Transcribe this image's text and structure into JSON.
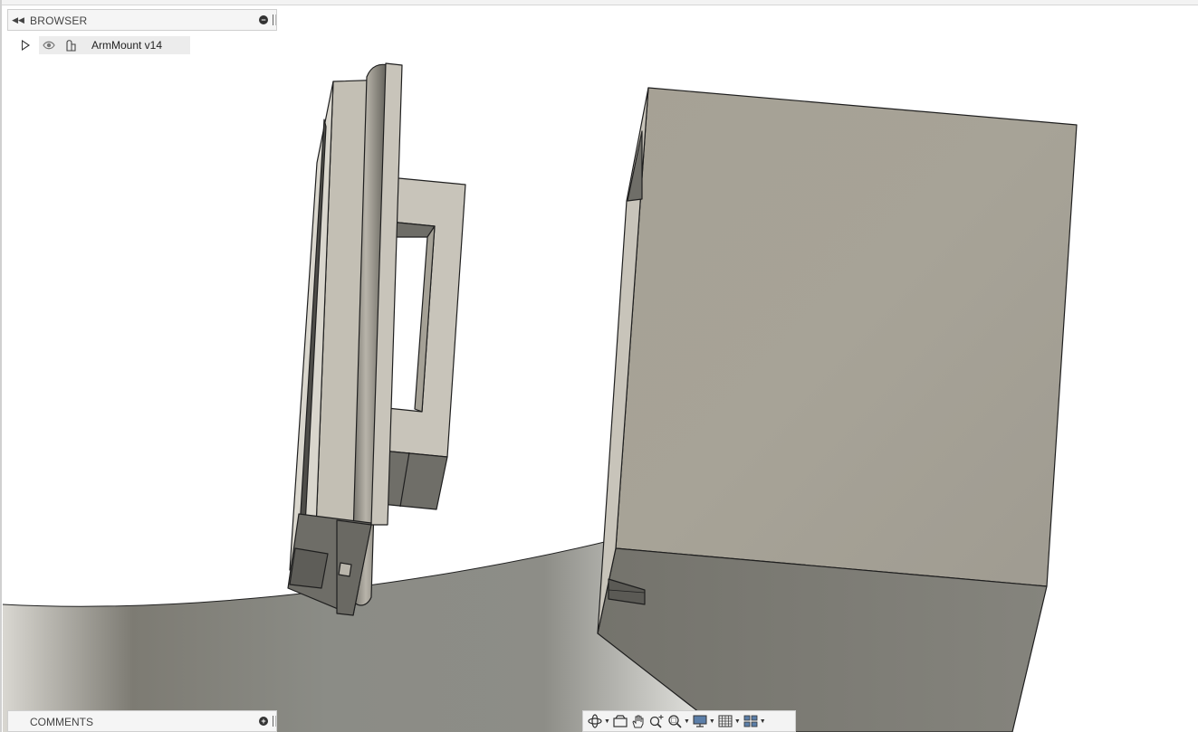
{
  "browser": {
    "title": "BROWSER",
    "collapse_icon": "double-chevron-left-icon",
    "close_icon": "minus-circle-icon",
    "items": [
      {
        "label": "ArmMount v14",
        "expand_icon": "triangle-right-icon",
        "visibility_icon": "eye-icon",
        "type_icon": "component-icon"
      }
    ]
  },
  "comments": {
    "title": "COMMENTS",
    "add_icon": "plus-circle-icon"
  },
  "nav_toolbar": {
    "tools": [
      {
        "name": "orbit",
        "icon": "orbit-icon",
        "has_dropdown": true
      },
      {
        "name": "look-at",
        "icon": "look-at-icon",
        "has_dropdown": false
      },
      {
        "name": "pan",
        "icon": "hand-icon",
        "has_dropdown": false
      },
      {
        "name": "zoom",
        "icon": "zoom-icon",
        "has_dropdown": false
      },
      {
        "name": "fit",
        "icon": "zoom-window-icon",
        "has_dropdown": true
      },
      {
        "name": "display-settings",
        "icon": "monitor-icon",
        "has_dropdown": true
      },
      {
        "name": "grid-and-snaps",
        "icon": "grid-icon",
        "has_dropdown": true
      },
      {
        "name": "viewports",
        "icon": "viewports-icon",
        "has_dropdown": true
      }
    ]
  },
  "colors": {
    "model_face_light": "#a9a49a",
    "model_face_mid": "#c9c5bb",
    "model_face_dark": "#7b7a73",
    "ground": "#9b9a92",
    "panel_bg": "#f5f5f5"
  }
}
